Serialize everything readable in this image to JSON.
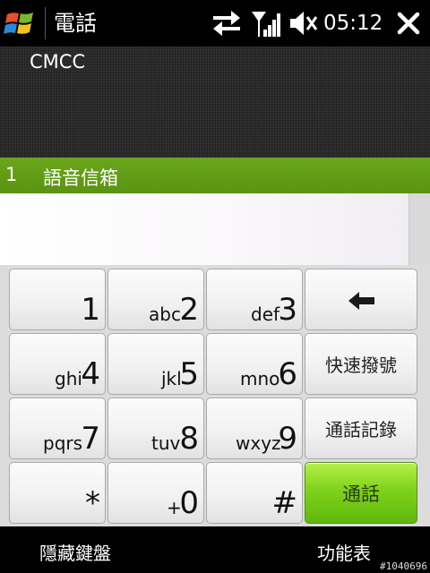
{
  "titlebar": {
    "title": "電話",
    "time": "05:12",
    "icons": {
      "start": "windows-flag-icon",
      "sync": "sync-arrows-icon",
      "signal": "signal-strength-icon",
      "volume": "speaker-muted-icon",
      "close": "close-icon"
    }
  },
  "carrier": {
    "name": "CMCC"
  },
  "speed_dial": {
    "index": "1",
    "label": "語音信箱"
  },
  "keypad": {
    "keys": [
      {
        "digit": "1",
        "letters": ""
      },
      {
        "digit": "2",
        "letters": "abc"
      },
      {
        "digit": "3",
        "letters": "def"
      },
      {
        "digit": "4",
        "letters": "ghi"
      },
      {
        "digit": "5",
        "letters": "jkl"
      },
      {
        "digit": "6",
        "letters": "mno"
      },
      {
        "digit": "7",
        "letters": "pqrs"
      },
      {
        "digit": "8",
        "letters": "tuv"
      },
      {
        "digit": "9",
        "letters": "wxyz"
      },
      {
        "digit": "*",
        "letters": ""
      },
      {
        "digit": "0",
        "letters": "+"
      },
      {
        "digit": "#",
        "letters": ""
      }
    ],
    "functions": {
      "backspace_icon": "backspace-arrow-icon",
      "speed_dial": "快速撥號",
      "call_log": "通話記錄",
      "call": "通話"
    }
  },
  "softkeys": {
    "left": "隱藏鍵盤",
    "right": "功能表"
  },
  "watermark": "#1040696",
  "colors": {
    "accent_green": "#6aa61a",
    "call_button_green": "#7fd21b",
    "background": "#000000"
  }
}
